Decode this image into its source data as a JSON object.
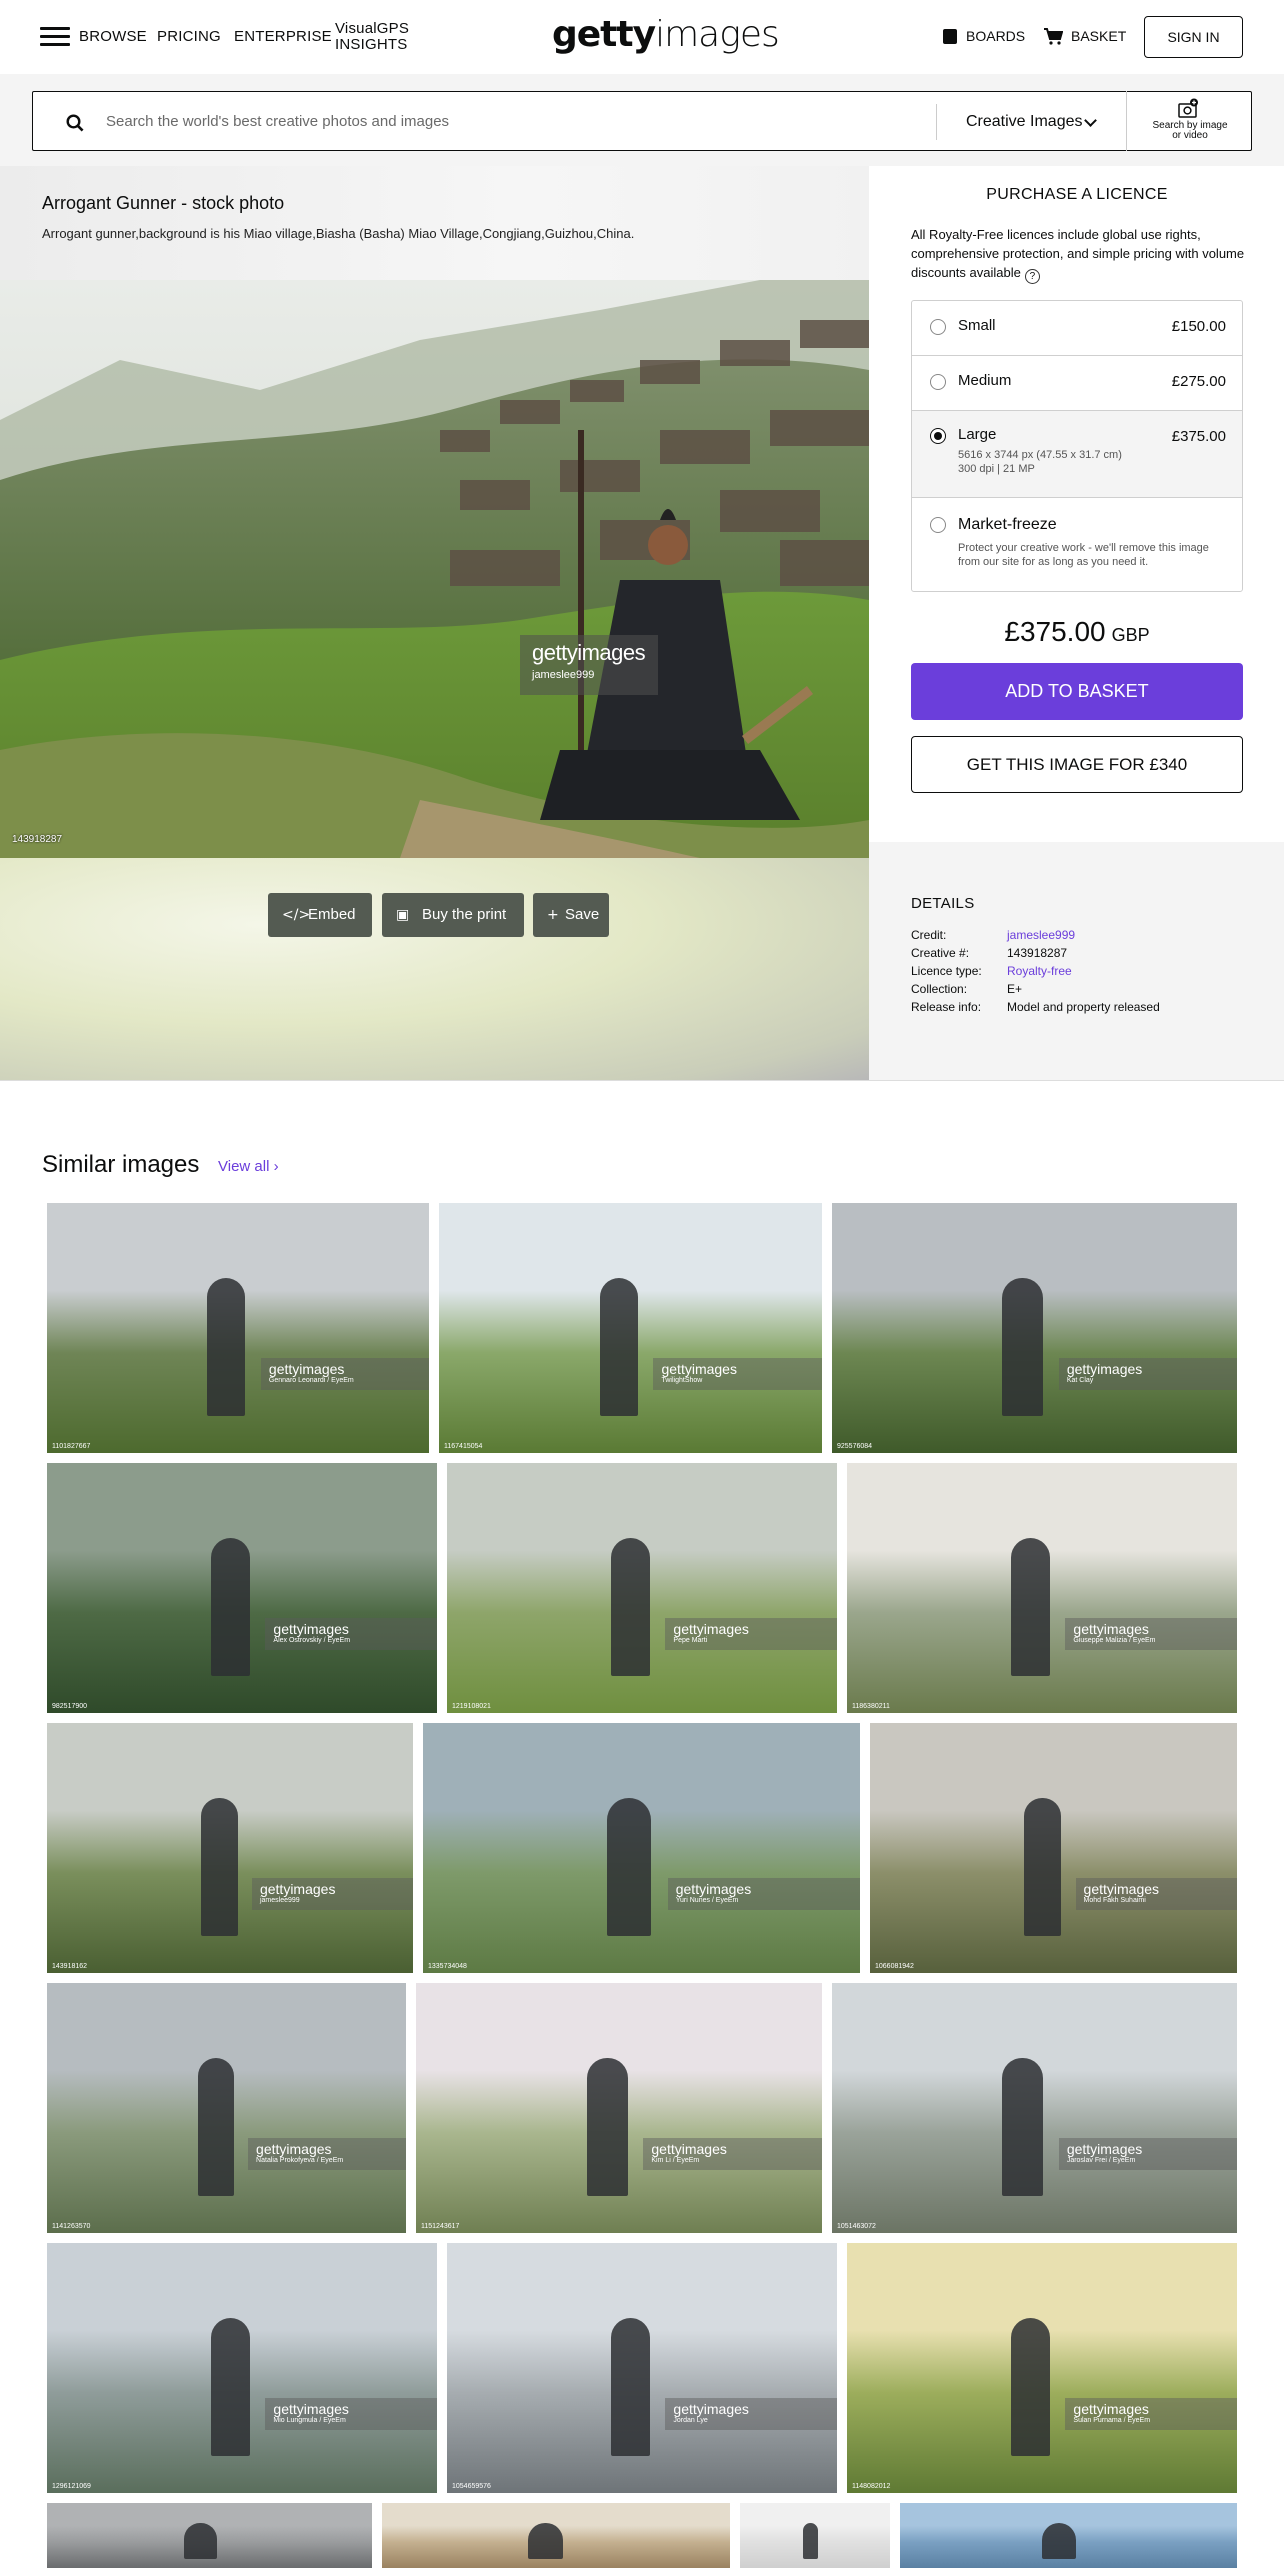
{
  "header": {
    "nav": [
      "BROWSE",
      "PRICING",
      "ENTERPRISE"
    ],
    "visualgps": [
      "VisualGPS",
      "INSIGHTS"
    ],
    "logo_bold": "getty",
    "logo_light": "images",
    "boards": "BOARDS",
    "basket": "BASKET",
    "signin": "SIGN IN"
  },
  "search": {
    "placeholder": "Search the world's best creative photos and images",
    "category": "Creative Images",
    "search_by_image": [
      "Search by image",
      "or video"
    ]
  },
  "photo": {
    "title": "Arrogant Gunner - stock photo",
    "caption": "Arrogant gunner,background is his Miao village,Biasha (Basha) Miao Village,Congjiang,Guizhou,China.",
    "image_id": "143918287",
    "watermark_logo": "gettyimages",
    "watermark_credit": "jameslee999"
  },
  "actions": {
    "embed": "Embed",
    "print": "Buy the print",
    "save": "Save"
  },
  "purchase": {
    "heading": "PURCHASE A LICENCE",
    "info": "All Royalty-Free licences include global use rights, comprehensive protection, and simple pricing with volume discounts available",
    "help": "?",
    "options": [
      {
        "name": "Small",
        "price": "£150.00"
      },
      {
        "name": "Medium",
        "price": "£275.00"
      },
      {
        "name": "Large",
        "price": "£375.00",
        "sub1": "5616 x 3744 px (47.55 x 31.7 cm)",
        "sub2": "300 dpi | 21 MP"
      },
      {
        "name": "Market-freeze",
        "sub": "Protect your creative work - we'll remove this image from our site for as long as you need it."
      }
    ],
    "selected": "Large",
    "total": "£375.00",
    "currency": "GBP",
    "add_basket": "ADD TO BASKET",
    "get_image": "GET THIS IMAGE FOR £340"
  },
  "details": {
    "heading": "DETAILS",
    "rows": [
      {
        "label": "Credit:",
        "value": "jameslee999"
      },
      {
        "label": "Creative #:",
        "value": "143918287"
      },
      {
        "label": "Licence type:",
        "value": "Royalty-free"
      },
      {
        "label": "Collection:",
        "value": "E+"
      },
      {
        "label": "Release info:",
        "value": "Model and property released"
      }
    ]
  },
  "similar": {
    "heading": "Similar images",
    "view_all": "View all",
    "watermark": "gettyimages",
    "tiles": [
      {
        "credit": "Gennaro Leonardi / EyeEm",
        "id": "1101827667"
      },
      {
        "credit": "TwilightShow",
        "id": "1167415054"
      },
      {
        "credit": "Kat Clay",
        "id": "925576084"
      },
      {
        "credit": "Alex Ostrovskiy / EyeEm",
        "id": "982517900"
      },
      {
        "credit": "Pepe Marti",
        "id": "1219108021"
      },
      {
        "credit": "Giuseppe Malizia / EyeEm",
        "id": "1186380211"
      },
      {
        "credit": "jameslee999",
        "id": "143918162"
      },
      {
        "credit": "Yuri Nunes / EyeEm",
        "id": "1335734048"
      },
      {
        "credit": "Mohd Fakh Suhaimi",
        "id": "1066081942"
      },
      {
        "credit": "Natalia Prokofyeva / EyeEm",
        "id": "1141263570"
      },
      {
        "credit": "Kim Li / EyeEm",
        "id": "1151243617"
      },
      {
        "credit": "Jaroslav Frei / EyeEm",
        "id": "1051463072"
      },
      {
        "credit": "Mio Lungmula / EyeEm",
        "id": "1296121069"
      },
      {
        "credit": "Jordan Lye",
        "id": "1054659576"
      },
      {
        "credit": "Sulan Purnama / EyeEm",
        "id": "1148082012"
      }
    ]
  },
  "colors": {
    "accent": "#6b3edb",
    "dark_button": "#545b52"
  }
}
